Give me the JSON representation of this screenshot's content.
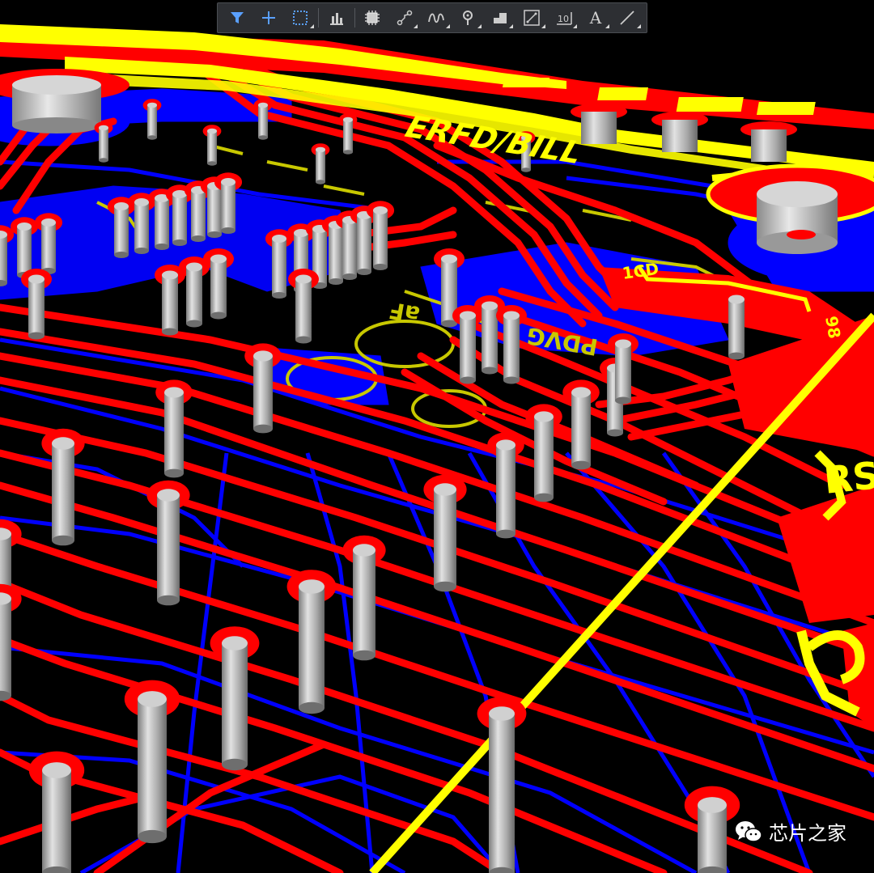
{
  "toolbar": {
    "items": [
      {
        "name": "filter-tool-button",
        "icon": "filter-icon"
      },
      {
        "name": "cross-probe-button",
        "icon": "crosshair-icon"
      },
      {
        "name": "select-area-button",
        "icon": "select-rect-icon"
      },
      {
        "name": "chart-tool-button",
        "icon": "bar-chart-icon"
      },
      {
        "name": "place-component-button",
        "icon": "chip-icon"
      },
      {
        "name": "route-track-button",
        "icon": "route-icon"
      },
      {
        "name": "interactive-route-button",
        "icon": "multi-route-icon"
      },
      {
        "name": "via-tool-button",
        "icon": "via-icon"
      },
      {
        "name": "polygon-pour-button",
        "icon": "polygon-icon"
      },
      {
        "name": "dimension-tool-button",
        "icon": "dimension-icon"
      },
      {
        "name": "designator-tool-button",
        "icon": "designator-icon"
      },
      {
        "name": "text-tool-button",
        "icon": "text-icon",
        "label": "A"
      },
      {
        "name": "line-tool-button",
        "icon": "line-icon"
      }
    ]
  },
  "board": {
    "colors": {
      "background": "#000000",
      "top_layer": "#ff0000",
      "bottom_layer": "#0000ff",
      "silkscreen": "#ffff00",
      "overlay_silk": "#c8c800",
      "via_barrel": "#b4b4b4"
    },
    "silk_labels": [
      "1CD",
      "ERFD/BILL",
      "RS",
      "R",
      "98",
      "PDVG",
      "aF"
    ]
  },
  "watermark": {
    "text": "芯片之家",
    "icon": "wechat-icon"
  }
}
